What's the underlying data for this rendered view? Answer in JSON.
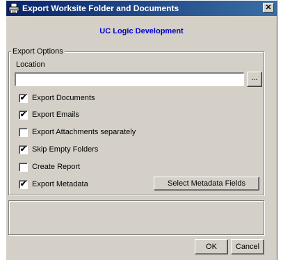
{
  "window": {
    "title": "Export Worksite Folder and Documents",
    "close_label": "✕",
    "title_gradient": [
      "#0a246a",
      "#3a6ea5"
    ]
  },
  "subtitle": "UC Logic Development",
  "subtitle_color": "#0000cc",
  "export_options": {
    "group_label": "Export Options",
    "location_label": "Location",
    "location_value": "",
    "browse_label": "...",
    "checkboxes": [
      {
        "label": "Export Documents",
        "checked": true
      },
      {
        "label": "Export Emails",
        "checked": true
      },
      {
        "label": "Export Attachments separately",
        "checked": false
      },
      {
        "label": "Skip Empty Folders",
        "checked": true
      },
      {
        "label": "Create Report",
        "checked": false
      },
      {
        "label": "Export Metadata",
        "checked": true
      }
    ],
    "metadata_button_label": "Select Metadata Fields"
  },
  "footer": {
    "ok_label": "OK",
    "cancel_label": "Cancel"
  },
  "icons": {
    "app": "printer-icon",
    "close": "close-icon"
  }
}
